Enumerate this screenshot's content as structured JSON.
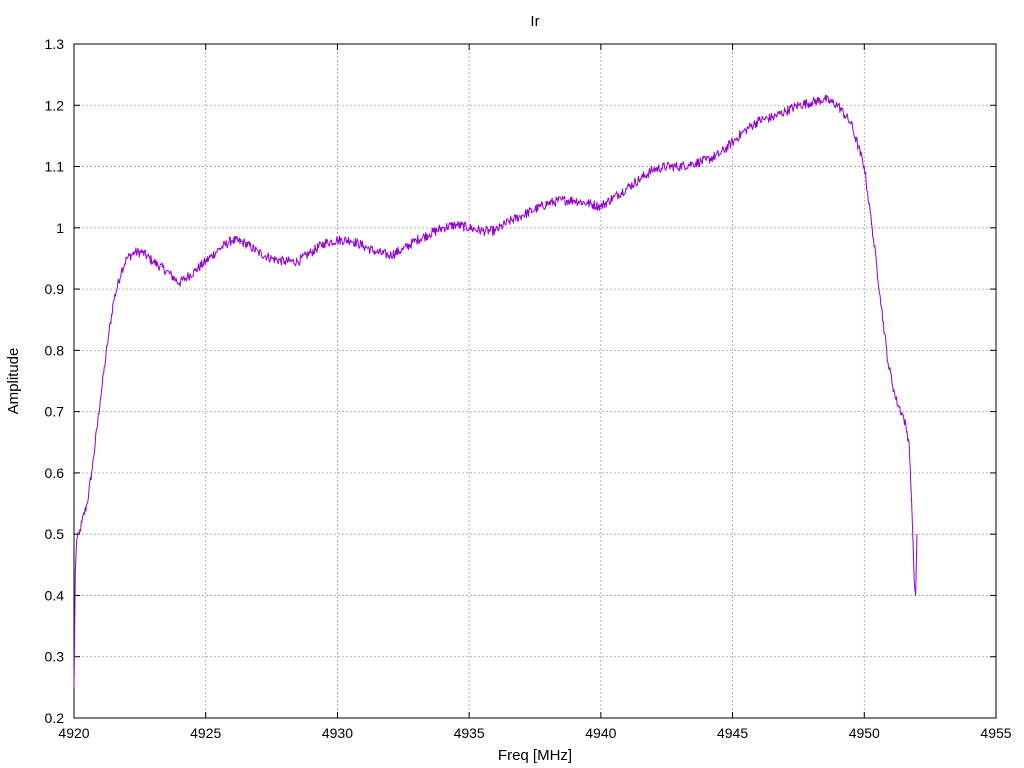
{
  "chart_data": {
    "type": "line",
    "title": "Ir",
    "xlabel": "Freq [MHz]",
    "ylabel": "Amplitude",
    "xlim": [
      4920,
      4955
    ],
    "ylim": [
      0.2,
      1.3
    ],
    "xticks": [
      4920,
      4925,
      4930,
      4935,
      4940,
      4945,
      4950,
      4955
    ],
    "yticks": [
      0.2,
      0.3,
      0.4,
      0.5,
      0.6,
      0.7,
      0.8,
      0.9,
      1.0,
      1.1,
      1.2,
      1.3
    ],
    "ytick_labels": [
      "0.2",
      "0.3",
      "0.4",
      "0.5",
      "0.6",
      "0.7",
      "0.8",
      "0.9",
      "1",
      "1.1",
      "1.2",
      "1.3"
    ],
    "grid": true,
    "legend": "none",
    "series": [
      {
        "color": "#9400d3",
        "x": [
          4920.0,
          4920.05,
          4920.1,
          4920.2,
          4920.3,
          4920.5,
          4920.7,
          4921.0,
          4921.3,
          4921.5,
          4921.8,
          4922.0,
          4922.3,
          4922.6,
          4923.0,
          4923.5,
          4924.0,
          4924.3,
          4924.6,
          4925.0,
          4925.5,
          4926.0,
          4926.5,
          4927.0,
          4927.5,
          4928.0,
          4928.5,
          4929.0,
          4929.5,
          4930.0,
          4930.5,
          4931.0,
          4931.5,
          4932.0,
          4932.5,
          4933.0,
          4933.5,
          4934.0,
          4934.5,
          4935.0,
          4935.5,
          4936.0,
          4936.5,
          4937.0,
          4937.5,
          4938.0,
          4938.5,
          4939.0,
          4939.5,
          4940.0,
          4940.5,
          4941.0,
          4941.5,
          4942.0,
          4942.5,
          4943.0,
          4943.5,
          4944.0,
          4944.5,
          4945.0,
          4945.5,
          4946.0,
          4946.5,
          4947.0,
          4947.5,
          4948.0,
          4948.5,
          4949.0,
          4949.5,
          4950.0,
          4950.3,
          4950.6,
          4950.9,
          4951.2,
          4951.5,
          4951.7,
          4951.8,
          4951.9,
          4951.95,
          4952.0
        ],
        "y": [
          0.25,
          0.44,
          0.49,
          0.5,
          0.52,
          0.55,
          0.61,
          0.72,
          0.82,
          0.88,
          0.93,
          0.95,
          0.96,
          0.96,
          0.945,
          0.93,
          0.91,
          0.92,
          0.93,
          0.945,
          0.965,
          0.98,
          0.975,
          0.96,
          0.95,
          0.945,
          0.945,
          0.96,
          0.975,
          0.98,
          0.98,
          0.97,
          0.96,
          0.955,
          0.965,
          0.98,
          0.99,
          1.0,
          1.005,
          1.0,
          0.995,
          0.995,
          1.01,
          1.02,
          1.03,
          1.04,
          1.045,
          1.045,
          1.04,
          1.035,
          1.05,
          1.065,
          1.08,
          1.095,
          1.1,
          1.1,
          1.105,
          1.11,
          1.12,
          1.14,
          1.16,
          1.175,
          1.18,
          1.19,
          1.2,
          1.205,
          1.21,
          1.2,
          1.17,
          1.1,
          1.0,
          0.89,
          0.78,
          0.72,
          0.69,
          0.65,
          0.55,
          0.42,
          0.4,
          0.5
        ]
      }
    ]
  }
}
